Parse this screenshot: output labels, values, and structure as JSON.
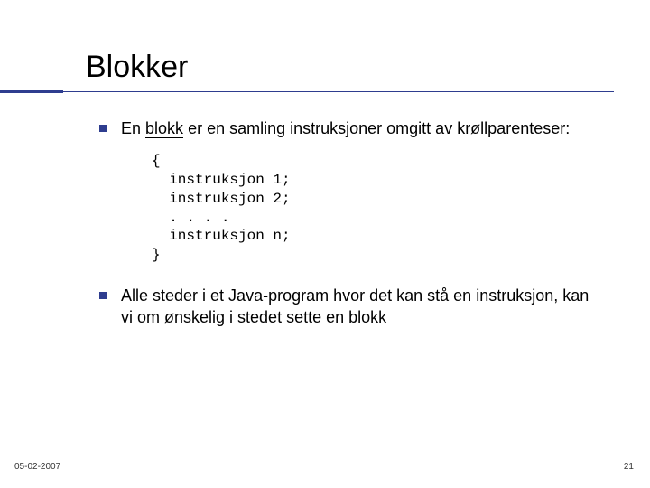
{
  "title": "Blokker",
  "bullets": [
    {
      "pre": "En ",
      "under": "blokk",
      "post": " er en samling instruksjoner omgitt av krøllparenteser:"
    },
    {
      "text": "Alle steder i et Java-program hvor det kan stå en instruksjon, kan vi om ønskelig i stedet sette en blokk"
    }
  ],
  "code": "{\n  instruksjon 1;\n  instruksjon 2;\n  . . . .\n  instruksjon n;\n}",
  "footer": {
    "date": "05-02-2007",
    "page": "21"
  }
}
